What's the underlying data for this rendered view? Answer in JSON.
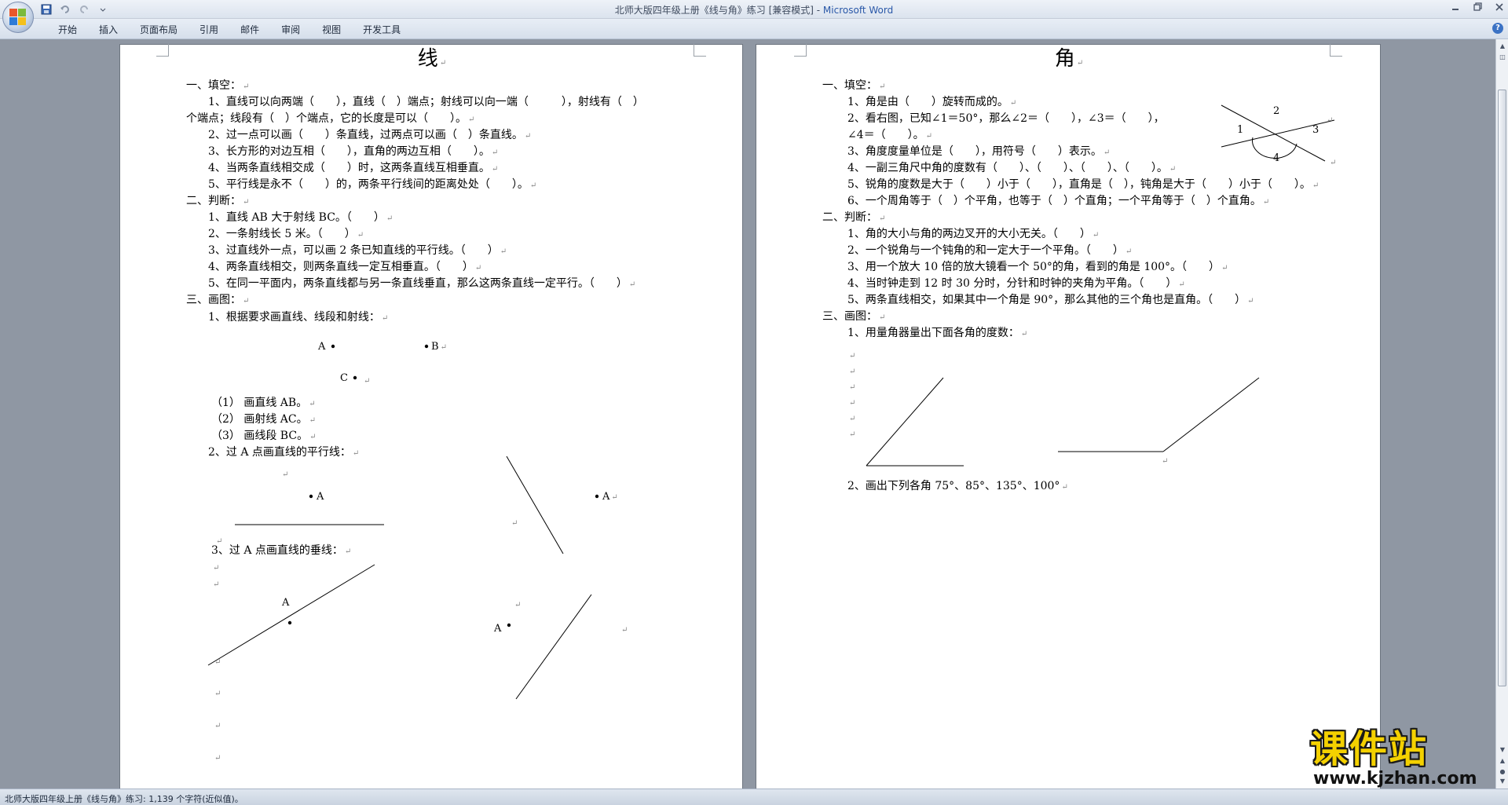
{
  "window": {
    "title_prefix": "北师大版四年级上册《线与角》练习 [兼容模式] - ",
    "title_app": "Microsoft Word"
  },
  "ribbon": {
    "tabs": [
      "开始",
      "插入",
      "页面布局",
      "引用",
      "邮件",
      "审阅",
      "视图",
      "开发工具"
    ]
  },
  "status": {
    "text": "北师大版四年级上册《线与角》练习: 1,139 个字符(近似值)。"
  },
  "left_page": {
    "title": "线",
    "lines": [
      "一、填空：",
      "1、直线可以向两端（　　），直线（　）端点；射线可以向一端（　　　），射线有（　）",
      "个端点；线段有（　）个端点，它的长度是可以（　　）。",
      "2、过一点可以画（　　）条直线，过两点可以画（　）条直线。",
      "3、长方形的对边互相（　　），直角的两边互相（　　）。",
      "4、当两条直线相交成（　　）时，这两条直线互相垂直。",
      "5、平行线是永不（　　）的，两条平行线间的距离处处（　　）。",
      "二、判断：",
      "1、直线 AB 大于射线 BC。（　　）",
      "2、一条射线长 5 米。（　　）",
      "3、过直线外一点，可以画 2 条已知直线的平行线。（　　）",
      "4、两条直线相交，则两条直线一定互相垂直。（　　）",
      "5、在同一平面内，两条直线都与另一条直线垂直，那么这两条直线一定平行。（　　）",
      "三、画图：",
      "1、根据要求画直线、线段和射线："
    ],
    "points": {
      "a": "A",
      "b": "B",
      "c": "C"
    },
    "sub_items": [
      "（1）  画直线 AB。",
      "（2）  画射线 AC。",
      "（3）  画线段 BC。"
    ],
    "q2": "2、过 A 点画直线的平行线：",
    "q3": "3、过 A 点画直线的垂线：",
    "label_a": "A"
  },
  "right_page": {
    "title": "角",
    "lines": [
      "一、填空：",
      "1、角是由（　　）旋转而成的。",
      "2、看右图，已知∠1＝50°，那么∠2＝（　　），∠3＝（　　），",
      "∠4＝（　　）。",
      "3、角度度量单位是（　　），用符号（　　）表示。",
      "4、一副三角尺中角的度数有（　　）、（　　）、（　　）、（　　）。",
      "5、锐角的度数是大于（　　）小于（　　），直角是（　），钝角是大于（　　）小于（　　）。",
      "6、一个周角等于（　）个平角，也等于（　）个直角；一个平角等于（　）个直角。",
      "二、判断：",
      "1、角的大小与角的两边叉开的大小无关。（　　）",
      "2、一个锐角与一个钝角的和一定大于一个平角。（　　）",
      "3、用一个放大 10 倍的放大镜看一个 50°的角，看到的角是 100°。（　　）",
      "4、当时钟走到 12 时 30 分时，分针和时钟的夹角为平角。（　　）",
      "5、两条直线相交，如果其中一个角是 90°，那么其他的三个角也是直角。（　　）",
      "三、画图：",
      "1、用量角器量出下面各角的度数："
    ],
    "angle_labels": [
      "1",
      "2",
      "3",
      "4"
    ],
    "q2": "2、画出下列各角 75°、85°、135°、100°"
  },
  "watermark": {
    "big": "课件站",
    "small": "www.kjzhan.com"
  },
  "colors": {
    "app_title": "#2a58a8",
    "watermark_fill": "#f4d100",
    "workspace": "#8f97a3"
  }
}
